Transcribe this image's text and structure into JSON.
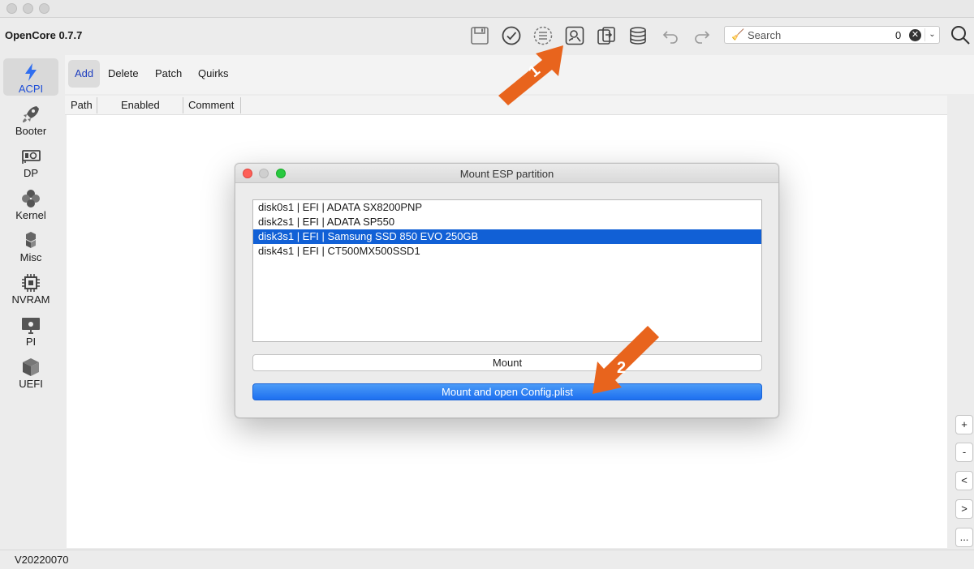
{
  "app": {
    "title": "OpenCore 0.7.7",
    "version_label": "V20220070"
  },
  "toolbar": {
    "icons": [
      "save-icon",
      "check-icon",
      "list-icon",
      "mount-esp-icon",
      "convert-icon",
      "database-icon",
      "undo-icon",
      "redo-icon"
    ],
    "search": {
      "placeholder": "Search",
      "count": "0",
      "clear_glyph": "✕",
      "dropdown_glyph": "⌄"
    }
  },
  "sidebar": {
    "items": [
      {
        "label": "ACPI",
        "icon": "lightning-icon",
        "active": true
      },
      {
        "label": "Booter",
        "icon": "rocket-icon"
      },
      {
        "label": "DP",
        "icon": "graphics-card-icon"
      },
      {
        "label": "Kernel",
        "icon": "kernel-icon"
      },
      {
        "label": "Misc",
        "icon": "cubes-icon"
      },
      {
        "label": "NVRAM",
        "icon": "chip-icon"
      },
      {
        "label": "PI",
        "icon": "apple-monitor-icon"
      },
      {
        "label": "UEFI",
        "icon": "box-icon"
      }
    ]
  },
  "subtabs": {
    "items": [
      {
        "label": "Add",
        "active": true
      },
      {
        "label": "Delete"
      },
      {
        "label": "Patch"
      },
      {
        "label": "Quirks"
      }
    ]
  },
  "table": {
    "columns": [
      "Path",
      "Enabled",
      "Comment"
    ]
  },
  "side_buttons": [
    "+",
    "-",
    "<",
    ">",
    "..."
  ],
  "dialog": {
    "title": "Mount ESP partition",
    "partitions": [
      "disk0s1 | EFI | ADATA SX8200PNP",
      "disk2s1 | EFI | ADATA SP550",
      "disk3s1 | EFI | Samsung SSD 850 EVO 250GB",
      "disk4s1 | EFI | CT500MX500SSD1"
    ],
    "selected_index": 2,
    "mount_button": "Mount",
    "mount_open_button": "Mount and open Config.plist"
  },
  "annotations": {
    "arrow1_label": "1",
    "arrow2_label": "2",
    "arrow_color": "#e8641d"
  },
  "colors": {
    "accent": "#1160d6",
    "selection": "#1160d6"
  }
}
